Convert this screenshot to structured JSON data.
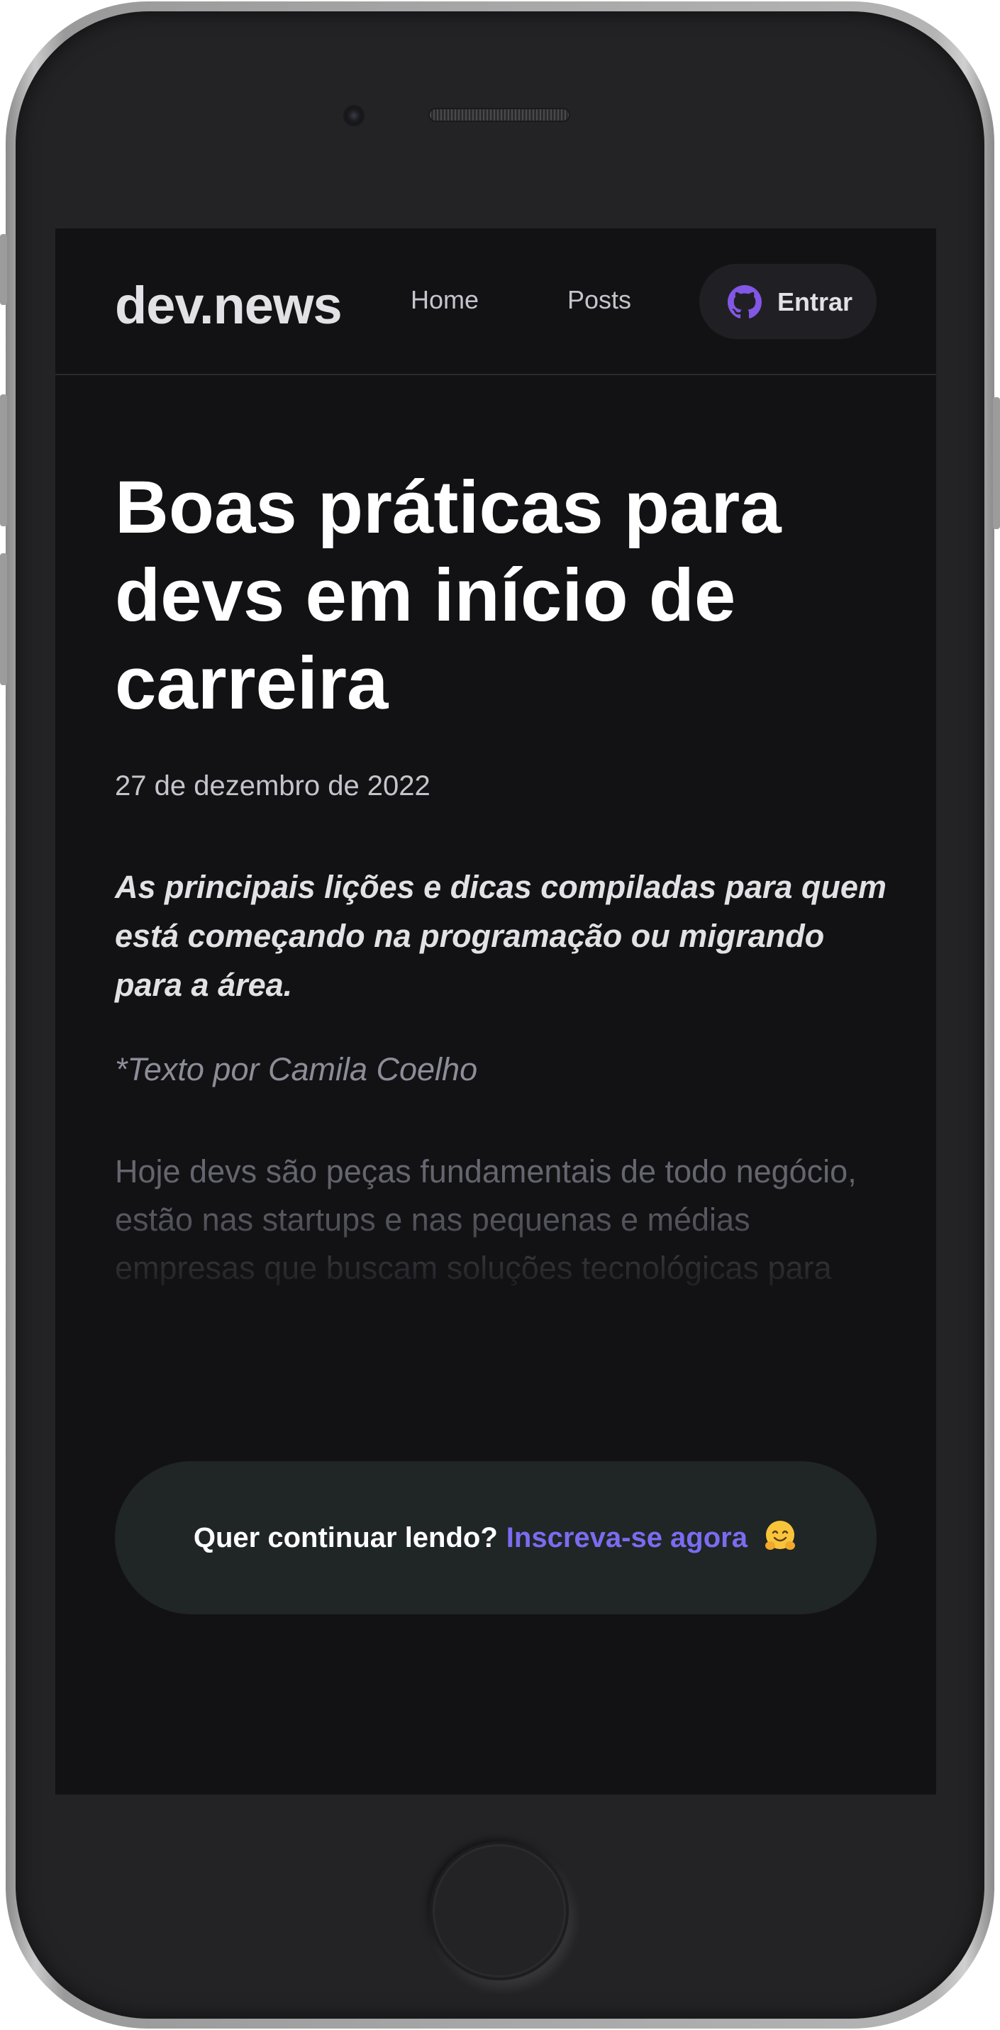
{
  "header": {
    "logo": "dev.news",
    "nav": [
      {
        "label": "Home"
      },
      {
        "label": "Posts"
      }
    ],
    "login_label": "Entrar",
    "login_icon": "github-icon"
  },
  "article": {
    "title": "Boas práticas para devs em início de carreira",
    "date": "27 de dezembro de 2022",
    "subtitle": "As principais lições e dicas compiladas para quem está começando na programação ou migrando para a área.",
    "author": "*Texto por Camila Coelho",
    "excerpt": "Hoje devs são peças fundamentais de todo negócio, estão nas startups e nas pequenas e médias empresas que buscam soluções tecnológicas para seus produtos e serviços."
  },
  "cta": {
    "question": "Quer continuar lendo?",
    "link": "Inscreva-se agora",
    "emoji_icon": "hugging-face-icon"
  },
  "colors": {
    "background": "#121214",
    "accent": "#7a6cf0",
    "github_icon": "#8257e5"
  }
}
